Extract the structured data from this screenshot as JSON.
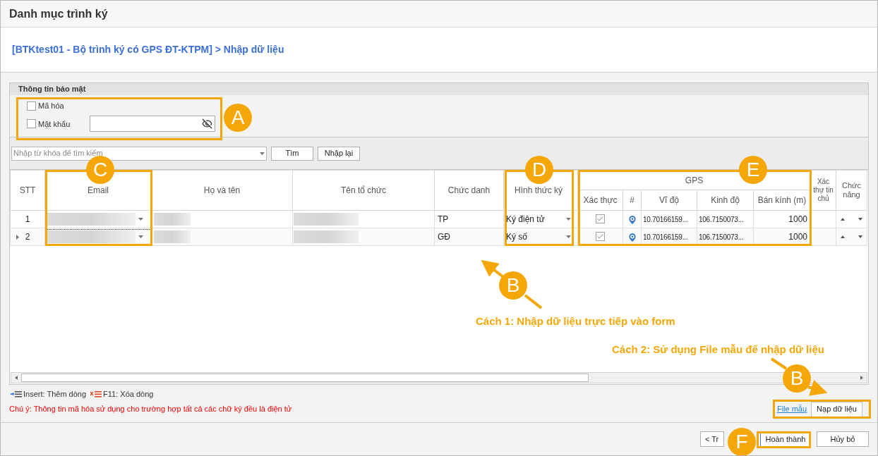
{
  "window": {
    "title": "Danh mục trình ký"
  },
  "breadcrumb": "[BTKtest01 - Bộ trình ký có GPS ĐT-KTPM] > Nhập dữ liệu",
  "security": {
    "title": "Thông tin bảo mật",
    "encrypt": {
      "label": "Mã hóa",
      "checked": false
    },
    "password": {
      "label": "Mật khẩu",
      "checked": false
    }
  },
  "search": {
    "placeholder": "Nhập từ khóa để tìm kiếm",
    "buttons": [
      "Tìm",
      "Nhập lại"
    ]
  },
  "table": {
    "columns": [
      "STT",
      "Email",
      "Họ và tên",
      "Tên tổ chức",
      "Chức danh",
      "Hình thức ký"
    ],
    "gps_group": "GPS",
    "gps_columns": [
      "Xác thực",
      "#",
      "Vĩ độ",
      "Kinh độ",
      "Bán kính (m)"
    ],
    "column_12": "Xác thự tin chủ",
    "actions_column": "Chức năng",
    "rows": [
      {
        "stt": "1",
        "selected": false,
        "title": "TP",
        "sign_type": "Ký điện tử",
        "verified": true,
        "lat": "10.70166159...",
        "lng": "106.7150073...",
        "radius": "1000"
      },
      {
        "stt": "2",
        "selected": true,
        "title": "GĐ",
        "sign_type": "Ký số",
        "verified": true,
        "lat": "10.70166159...",
        "lng": "106.7150073...",
        "radius": "1000"
      }
    ]
  },
  "legend": [
    "Insert: Thêm dòng",
    "F11: Xóa dòng"
  ],
  "note": "Chú ý: Thông tin mã hóa sử dụng cho trường hợp tất cả các chữ ký đều là điện tử",
  "file_links": {
    "template": "File mẫu",
    "load": "Nạp dữ liệu"
  },
  "footer_buttons": [
    "< Tr",
    "Hoàn thành",
    "Hủy bỏ"
  ],
  "annotations": {
    "badges": [
      "A",
      "C",
      "D",
      "E",
      "B",
      "B",
      "F"
    ],
    "captions": [
      "Cách 1: Nhập dữ liệu trực tiếp vào form",
      "Cách 2: Sử dụng File mẫu để nhập dữ liệu"
    ]
  }
}
